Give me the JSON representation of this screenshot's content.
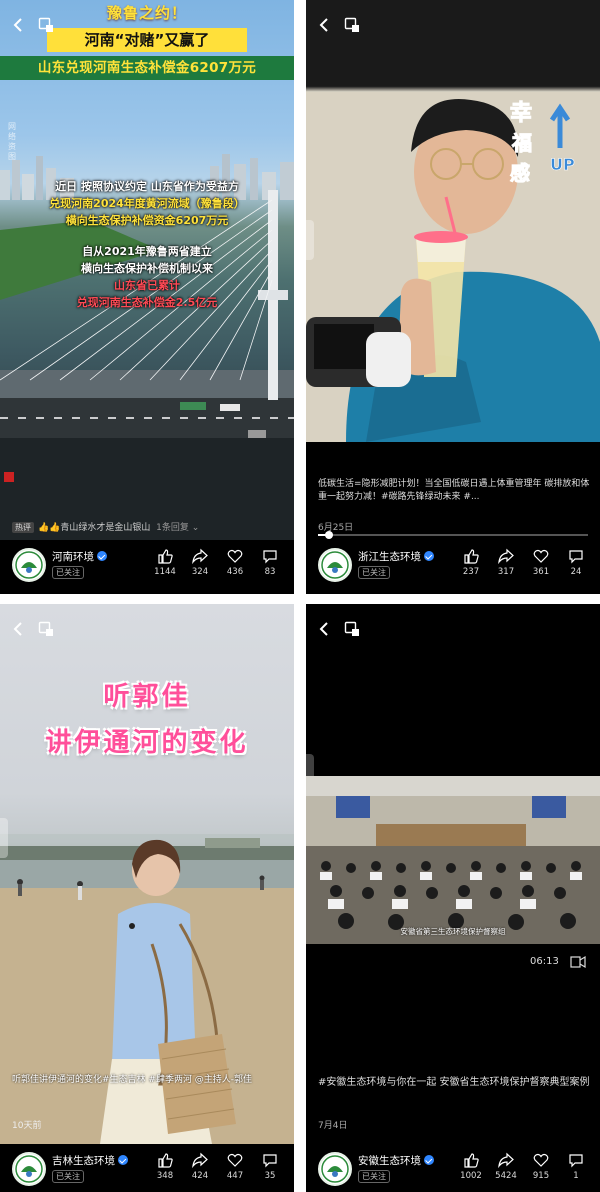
{
  "feed": [
    {
      "title_line1": "豫鲁之约！",
      "title_line2": "河南“对赌”又赢了",
      "title_line3": "山东兑现河南生态补偿金6207万元",
      "watermark": "网络资图",
      "body_line1": "近日 按照协议约定 山东省作为受益方",
      "body_line2": "兑现河南2024年度黄河流域（豫鲁段）",
      "body_line3": "横向生态保护补偿资金6207万元",
      "body_line4": "自从2021年豫鲁两省建立",
      "body_line5": "横向生态保护补偿机制以来",
      "body_line6": "山东省已累计",
      "body_line7": "兑现河南生态补偿金2.5亿元",
      "hot_tag": "热评",
      "hot_text": "👍👍青山绿水才是金山银山",
      "hot_replies": "1条回复",
      "account": "河南环境",
      "follow": "已关注",
      "likes": "1144",
      "shares": "324",
      "favorites": "436",
      "comments": "83"
    },
    {
      "sticker_text": "幸福感UP",
      "caption": "低碳生活=隐形减肥计划！当全国低碳日遇上体重管理年 碳排放和体重一起努力减！#碳路先锋绿动未来 #...",
      "date": "6月25日",
      "account": "浙江生态环境",
      "follow": "已关注",
      "likes": "237",
      "shares": "317",
      "favorites": "361",
      "comments": "24"
    },
    {
      "title_line1": "听郭佳",
      "title_line2": "讲伊通河的变化",
      "caption": "听郭佳讲伊通河的变化#生态吉林 #肆季两河 @主持人-郭佳",
      "date": "10天前",
      "account": "吉林生态环境",
      "follow": "已关注",
      "likes": "348",
      "shares": "424",
      "favorites": "447",
      "comments": "35"
    },
    {
      "video_subtitle": "安徽省第三生态环境保护督察组",
      "duration": "06:13",
      "caption": "#安徽生态环境与你在一起 安徽省生态环境保护督察典型案例",
      "date": "7月4日",
      "account": "安徽生态环境",
      "follow": "已关注",
      "likes": "1002",
      "shares": "5424",
      "favorites": "915",
      "comments": "1"
    }
  ],
  "progress": [
    0.04,
    0.04
  ],
  "colors": {
    "accent_yellow": "#ffe23a",
    "accent_red": "#ff4a55",
    "title_pink": "#ff4f9a",
    "verify_blue": "#2f86ff"
  },
  "icons": [
    "back-icon",
    "pip-icon",
    "like-icon",
    "share-icon",
    "favorite-icon",
    "comment-icon",
    "verified-icon",
    "mute-icon"
  ]
}
